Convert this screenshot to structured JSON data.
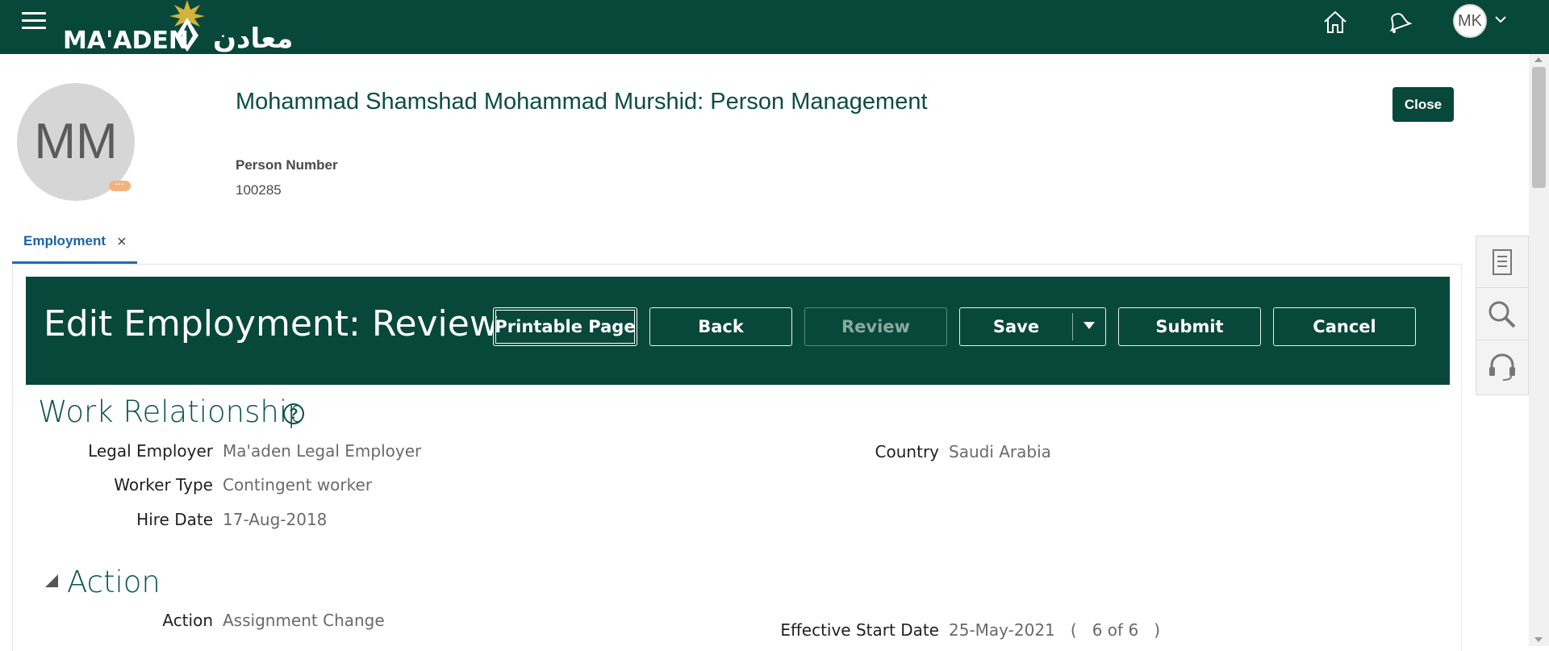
{
  "brand": {
    "logo_text_en": "MA'ADEN",
    "logo_text_ar": "معادن"
  },
  "topbar": {
    "user_initials": "MK"
  },
  "header": {
    "avatar_initials": "MM",
    "avatar_badge": "···",
    "title": "Mohammad Shamshad Mohammad Murshid: Person Management",
    "close_label": "Close",
    "person_number_label": "Person Number",
    "person_number_value": "100285"
  },
  "tabs": [
    {
      "label": "Employment",
      "close": "×"
    }
  ],
  "banner": {
    "title": "Edit Employment: Review",
    "buttons": {
      "printable": "Printable Page",
      "back": "Back",
      "review": "Review",
      "save": "Save",
      "submit": "Submit",
      "cancel": "Cancel"
    }
  },
  "work_relationship": {
    "title": "Work Relationship",
    "help": "?",
    "legal_employer_label": "Legal Employer",
    "legal_employer_value": "Ma'aden Legal Employer",
    "worker_type_label": "Worker Type",
    "worker_type_value": "Contingent worker",
    "hire_date_label": "Hire Date",
    "hire_date_value": "17-Aug-2018",
    "country_label": "Country",
    "country_value": "Saudi Arabia"
  },
  "action_section": {
    "title": "Action",
    "action_label": "Action",
    "action_value": "Assignment Change",
    "effective_start_label": "Effective Start Date",
    "effective_start_value": "25-May-2021   (   6 of 6   )"
  },
  "colors": {
    "brand_green": "#07483a",
    "tab_blue": "#1d63a6",
    "badge_orange": "#f3b27a"
  },
  "icons": [
    "hamburger-icon",
    "home-icon",
    "notifications-bell-icon",
    "chevron-down-icon",
    "document-icon",
    "search-icon",
    "headset-icon",
    "help-icon"
  ]
}
